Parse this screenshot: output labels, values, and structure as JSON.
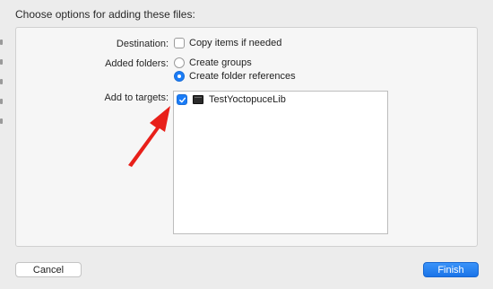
{
  "dialog": {
    "title": "Choose options for adding these files:"
  },
  "destination": {
    "label": "Destination:",
    "checkbox_label": "Copy items if needed",
    "checked": false
  },
  "added_folders": {
    "label": "Added folders:",
    "options": [
      {
        "label": "Create groups",
        "selected": false
      },
      {
        "label": "Create folder references",
        "selected": true
      }
    ]
  },
  "targets": {
    "label": "Add to targets:",
    "items": [
      {
        "name": "TestYoctopuceLib",
        "checked": true,
        "icon": "terminal-app-icon"
      }
    ]
  },
  "buttons": {
    "cancel": "Cancel",
    "finish": "Finish"
  },
  "colors": {
    "accent": "#1a7cf7",
    "annotation_arrow": "#e8201a"
  }
}
